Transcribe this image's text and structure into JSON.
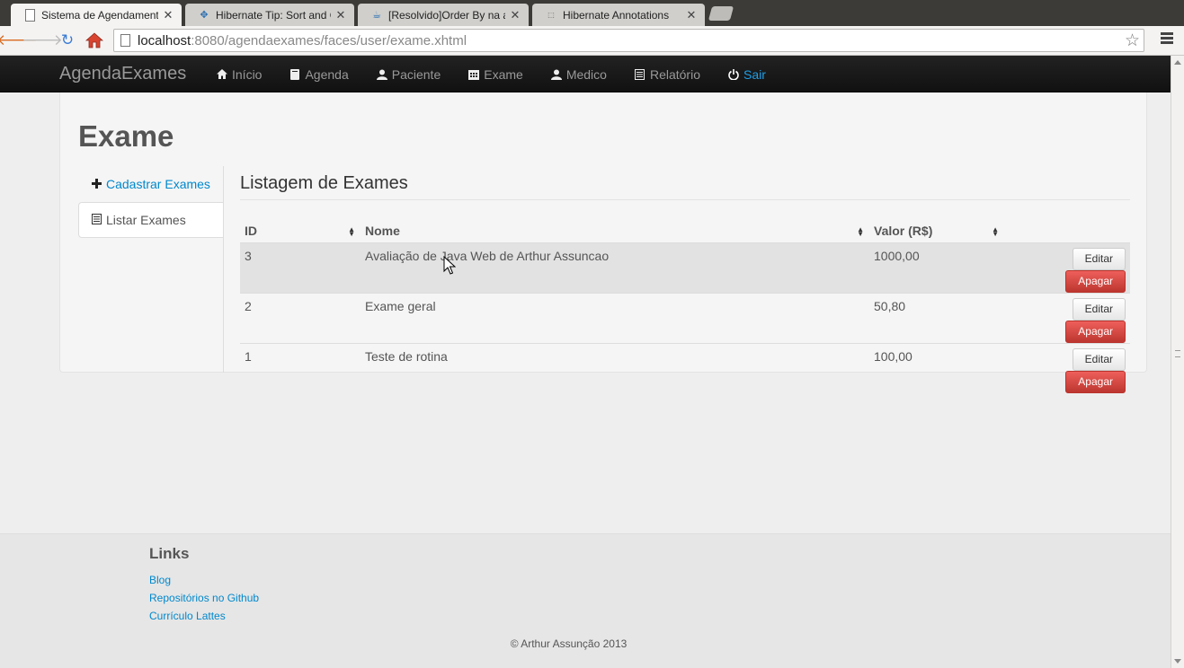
{
  "browser": {
    "tabs": [
      {
        "title": "Sistema de Agendamento",
        "favicon": "page-icon"
      },
      {
        "title": "Hibernate Tip: Sort and O",
        "favicon": "dots-icon"
      },
      {
        "title": "[Resolvido]Order By na ar",
        "favicon": "coffee-icon"
      },
      {
        "title": "Hibernate Annotations",
        "favicon": "jboss-icon"
      }
    ],
    "url_host": "localhost",
    "url_rest": ":8080/agendaexames/faces/user/exame.xhtml"
  },
  "navbar": {
    "brand": "AgendaExames",
    "items": [
      {
        "label": "Início",
        "icon": "home-icon"
      },
      {
        "label": "Agenda",
        "icon": "book-icon"
      },
      {
        "label": "Paciente",
        "icon": "user-icon"
      },
      {
        "label": "Exame",
        "icon": "calendar-icon"
      },
      {
        "label": "Medico",
        "icon": "user-icon"
      },
      {
        "label": "Relatório",
        "icon": "list-icon"
      },
      {
        "label": "Sair",
        "icon": "power-icon"
      }
    ]
  },
  "page": {
    "title": "Exame",
    "sidenav": [
      {
        "label": "Cadastrar Exames",
        "icon": "plus-icon"
      },
      {
        "label": "Listar Exames",
        "icon": "list-icon"
      }
    ],
    "section_title": "Listagem de Exames",
    "table": {
      "headers": [
        "ID",
        "Nome",
        "Valor (R$)"
      ],
      "rows": [
        {
          "id": "3",
          "nome": "Avaliação de Java Web de Arthur Assuncao",
          "valor": "1000,00"
        },
        {
          "id": "2",
          "nome": "Exame geral",
          "valor": "50,80"
        },
        {
          "id": "1",
          "nome": "Teste de rotina",
          "valor": "100,00"
        }
      ],
      "edit_label": "Editar",
      "delete_label": "Apagar"
    }
  },
  "footer": {
    "heading": "Links",
    "links": [
      "Blog",
      "Repositórios no Github",
      "Currículo Lattes"
    ],
    "copyright": "© Arthur Assunção 2013"
  },
  "colors": {
    "link": "#0088cc",
    "danger": "#bd362f",
    "navbar": "#1b1b1b"
  }
}
